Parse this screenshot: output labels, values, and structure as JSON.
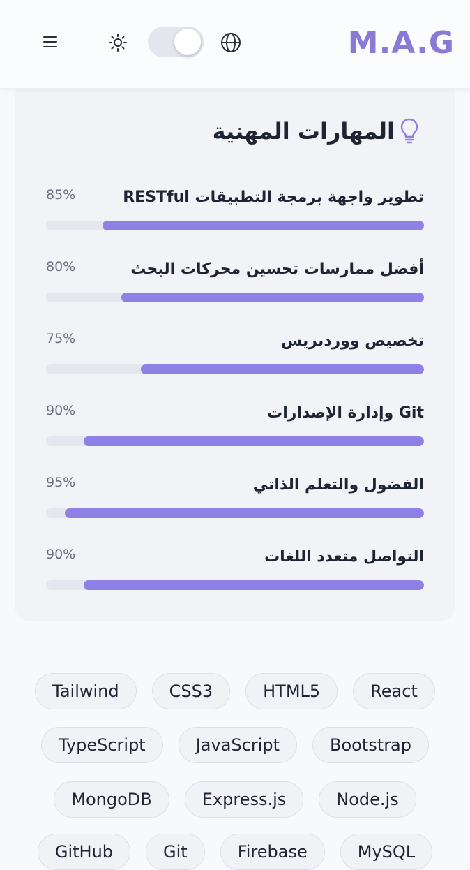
{
  "header": {
    "logo": "M.A.G"
  },
  "icons": {
    "menu": "hamburger-menu-icon",
    "theme": "sun-icon",
    "language": "globe-icon",
    "title": "lightbulb-icon"
  },
  "colors": {
    "accent": "#8f80e6",
    "logo": "#8a7ad6",
    "card_bg": "#f2f3f7"
  },
  "skills_section": {
    "title": "المهارات المهنية",
    "skills": [
      {
        "name": "تطوير واجهة برمجة التطبيقات RESTful",
        "percent_label": "85%",
        "value": 0.85
      },
      {
        "name": "أفضل ممارسات تحسين محركات البحث",
        "percent_label": "80%",
        "value": 0.8
      },
      {
        "name": "تخصيص ووردبريس",
        "percent_label": "75%",
        "value": 0.75
      },
      {
        "name": "Git وإدارة الإصدارات",
        "percent_label": "90%",
        "value": 0.9
      },
      {
        "name": "الفضول والتعلم الذاتي",
        "percent_label": "95%",
        "value": 0.95
      },
      {
        "name": "التواصل متعدد اللغات",
        "percent_label": "90%",
        "value": 0.9
      }
    ]
  },
  "tags": [
    [
      "Tailwind",
      "CSS3",
      "HTML5",
      "React"
    ],
    [
      "TypeScript",
      "JavaScript",
      "Bootstrap"
    ],
    [
      "MongoDB",
      "Express.js",
      "Node.js"
    ],
    [
      "GitHub",
      "Git",
      "Firebase",
      "MySQL"
    ]
  ]
}
